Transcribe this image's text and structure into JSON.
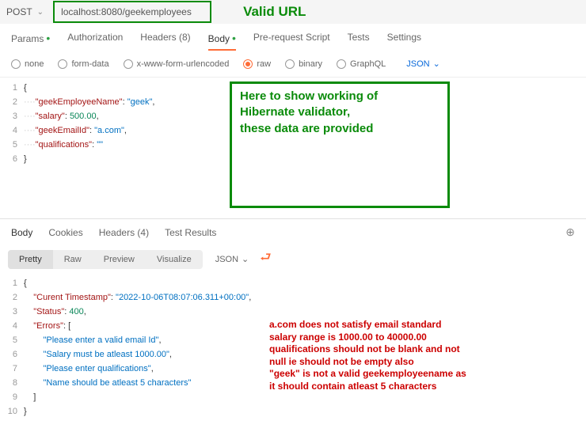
{
  "request": {
    "method": "POST",
    "url": "localhost:8080/geekemployees",
    "valid_label": "Valid URL"
  },
  "tabs": {
    "params": "Params",
    "auth": "Authorization",
    "headers": "Headers (8)",
    "body": "Body",
    "prereq": "Pre-request Script",
    "tests": "Tests",
    "settings": "Settings"
  },
  "body_types": {
    "none": "none",
    "formdata": "form-data",
    "urlenc": "x-www-form-urlencoded",
    "raw": "raw",
    "binary": "binary",
    "graphql": "GraphQL",
    "json": "JSON"
  },
  "req_body": {
    "l2": "\"geekEmployeeName\": \"geek\",",
    "l3": "\"salary\": 500.00,",
    "l4": "\"geekEmailId\": \"a.com\",",
    "l5": "\"qualifications\": \"\""
  },
  "anno1": {
    "l1": "Here to show working of",
    "l2": "Hibernate validator,",
    "l3": "these data are provided"
  },
  "resp_tabs": {
    "body": "Body",
    "cookies": "Cookies",
    "headers": "Headers (4)",
    "tests": "Test Results"
  },
  "pretty": {
    "pretty": "Pretty",
    "raw": "Raw",
    "preview": "Preview",
    "viz": "Visualize",
    "json": "JSON"
  },
  "resp_body": {
    "l2": "\"Curent Timestamp\": \"2022-10-06T08:07:06.311+00:00\",",
    "l3": "\"Status\": 400,",
    "l4": "\"Errors\": [",
    "l5": "\"Please enter a valid email Id\",",
    "l6": "\"Salary must be atleast 1000.00\",",
    "l7": "\"Please enter qualifications\",",
    "l8": "\"Name should be atleast 5 characters\"",
    "l9": "]"
  },
  "anno2": {
    "l1": "a.com does not satisfy email standard",
    "l2": "salary range is 1000.00 to 40000.00",
    "l3": "qualifications should not be blank and not",
    "l4": "null ie should not be empty also",
    "l5": "\"geek\" is not a valid geekemployeename as",
    "l6": "it should contain atleast 5 characters"
  }
}
